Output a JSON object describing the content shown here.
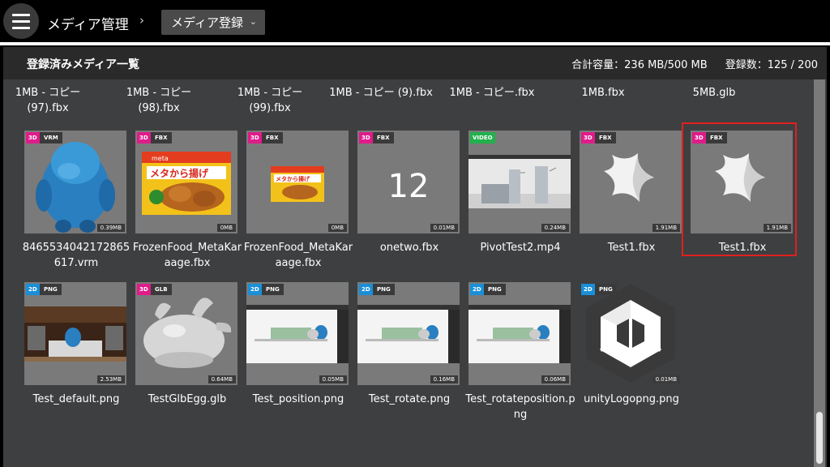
{
  "header": {
    "app_title": "メディア管理",
    "separator": "›",
    "dropdown_label": "メディア登録",
    "dropdown_chevron": "⌄"
  },
  "panel": {
    "title": "登録済みメディア一覧",
    "capacity_label": "合計容量：",
    "capacity_value": "236 MB/500 MB",
    "count_label": "登録数：",
    "count_value": "125 / 200"
  },
  "partial_row": [
    "1MB - コピー\n(97).fbx",
    "1MB - コピー\n(98).fbx",
    "1MB - コピー\n(99).fbx",
    "1MB - コピー (9).fbx",
    "1MB - コピー.fbx",
    "1MB.fbx",
    "5MB.glb"
  ],
  "items": [
    {
      "dim": "3D",
      "format": "VRM",
      "size": "0.39MB",
      "name": "8465534042172865617.vrm",
      "icon": "blue-character"
    },
    {
      "dim": "3D",
      "format": "FBX",
      "size": "0MB",
      "name": "FrozenFood_MetaKaraage.fbx",
      "icon": "karaage-package"
    },
    {
      "dim": "3D",
      "format": "FBX",
      "size": "0MB",
      "name": "FrozenFood_MetaKaraage.fbx",
      "icon": "karaage-package-small"
    },
    {
      "dim": "3D",
      "format": "FBX",
      "size": "0.01MB",
      "name": "onetwo.fbx",
      "thumb_text": "12",
      "icon": "text-12"
    },
    {
      "dim": "",
      "format": "VIDEO",
      "size": "0.24MB",
      "name": "PivotTest2.mp4",
      "icon": "video-scene"
    },
    {
      "dim": "3D",
      "format": "FBX",
      "size": "1.91MB",
      "name": "Test1.fbx",
      "icon": "star-shape"
    },
    {
      "dim": "3D",
      "format": "FBX",
      "size": "1.91MB",
      "name": "Test1.fbx",
      "icon": "star-shape"
    },
    {
      "dim": "2D",
      "format": "PNG",
      "size": "2.53MB",
      "name": "Test_default.png",
      "icon": "room-scene"
    },
    {
      "dim": "3D",
      "format": "GLB",
      "size": "0.64MB",
      "name": "TestGlbEgg.glb",
      "icon": "egg-creature"
    },
    {
      "dim": "2D",
      "format": "PNG",
      "size": "0.05MB",
      "name": "Test_position.png",
      "icon": "screenshot"
    },
    {
      "dim": "2D",
      "format": "PNG",
      "size": "0.16MB",
      "name": "Test_rotate.png",
      "icon": "screenshot"
    },
    {
      "dim": "2D",
      "format": "PNG",
      "size": "0.06MB",
      "name": "Test_rotateposition.png",
      "icon": "screenshot"
    },
    {
      "dim": "2D",
      "format": "PNG",
      "size": "0.01MB",
      "name": "unityLogopng.png",
      "icon": "unity-logo"
    }
  ],
  "colors": {
    "badge_3d": "#e01b8a",
    "badge_2d": "#1a8fd8",
    "badge_video": "#22b14c",
    "selection": "#e02020",
    "panel_bg": "#3e3f41"
  }
}
